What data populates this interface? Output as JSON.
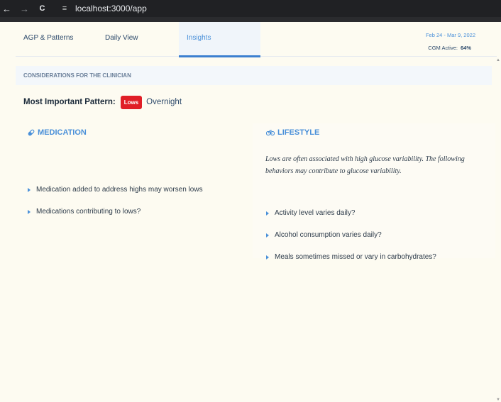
{
  "browser": {
    "back_icon": "←",
    "forward_icon": "→",
    "reload_icon": "C",
    "site_info_icon": "≡",
    "url": "localhost:3000/app"
  },
  "tabs": [
    {
      "label": "AGP & Patterns",
      "active": false
    },
    {
      "label": "Daily View",
      "active": false
    },
    {
      "label": "Insights",
      "active": true
    }
  ],
  "header": {
    "date_range": "Feb 24 - Mar 9, 2022",
    "cgm_label": "CGM Active:",
    "cgm_value": "64%"
  },
  "considerations": {
    "title": "CONSIDERATIONS FOR THE CLINICIAN",
    "pattern_label": "Most Important Pattern:",
    "pattern_badge": "Lows",
    "pattern_time": "Overnight"
  },
  "medication": {
    "title": "MEDICATION",
    "items": [
      "Medication added to address highs may worsen lows",
      "Medications contributing to lows?"
    ]
  },
  "lifestyle": {
    "title": "LIFESTYLE",
    "note": "Lows are often associated with high glucose variability. The following behaviors may contribute to glucose variability.",
    "items": [
      "Activity level varies daily?",
      "Alcohol consumption varies daily?",
      "Meals sometimes missed or vary in carbohydrates?"
    ]
  },
  "colors": {
    "accent": "#4a90d9",
    "badge_red": "#e01e26",
    "background": "#fdfbf1"
  }
}
